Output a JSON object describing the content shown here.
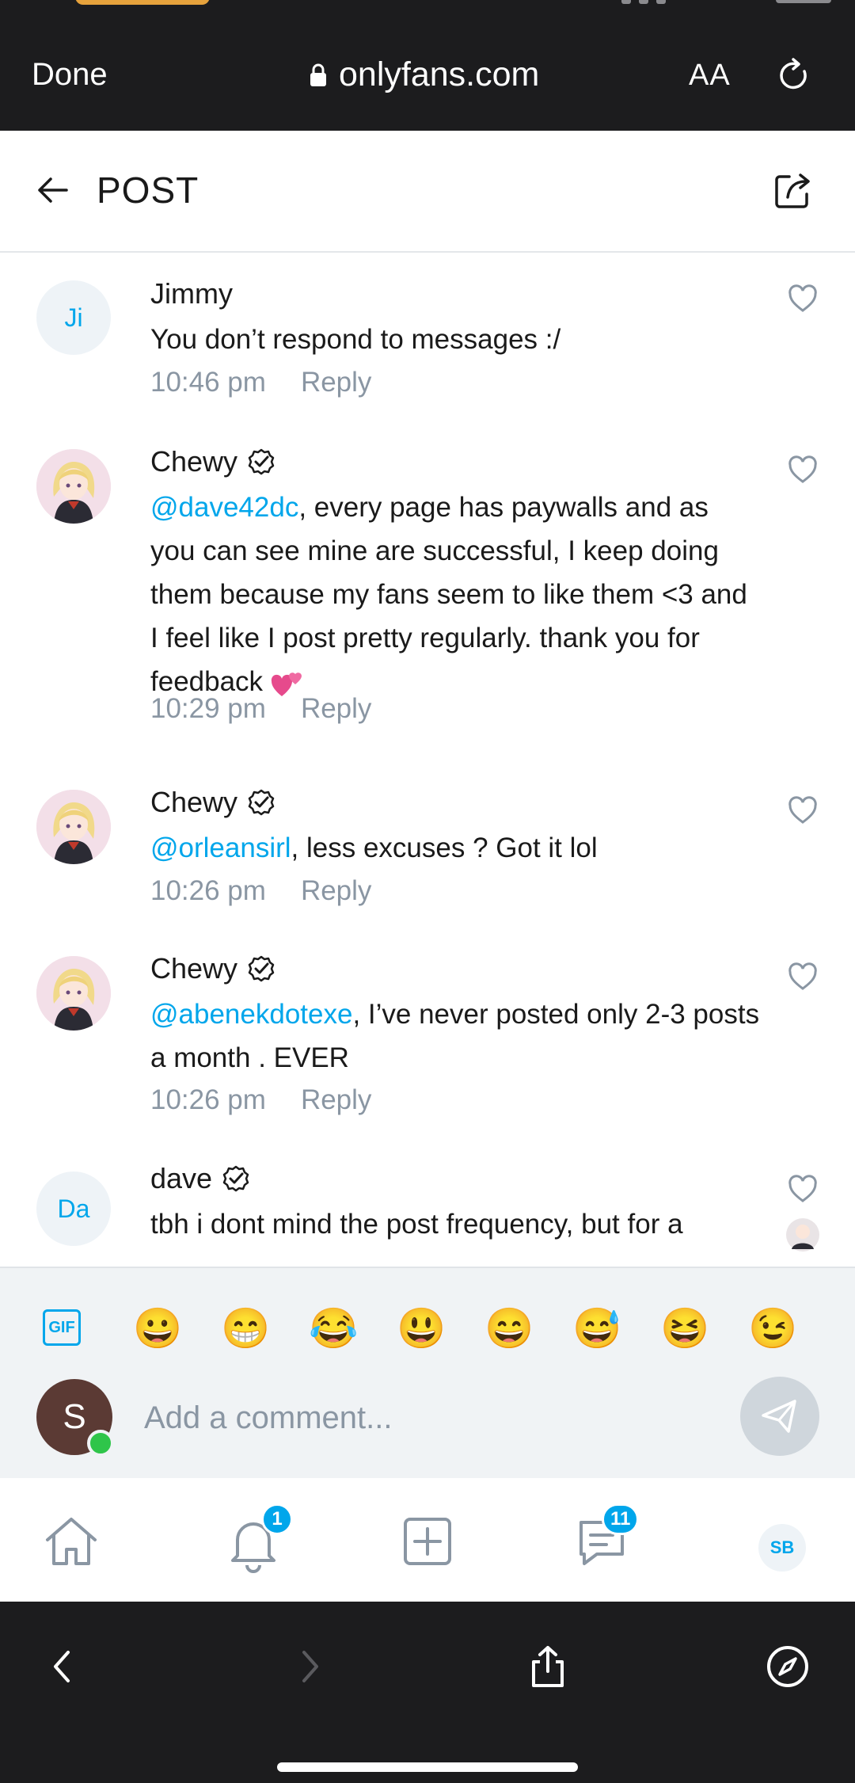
{
  "browser": {
    "done_label": "Done",
    "url": "onlyfans.com",
    "text_size_label": "AA"
  },
  "header": {
    "title": "POST"
  },
  "comments": [
    {
      "avatar_initials": "Ji",
      "name": "Jimmy",
      "verified": false,
      "mention": "",
      "text": "You don’t respond to messages :/",
      "time": "10:46 pm",
      "reply_label": "Reply"
    },
    {
      "avatar_initials": "",
      "name": "Chewy",
      "verified": true,
      "mention": "@dave42dc",
      "text": ", every page has paywalls and as you can see mine are successful, I keep doing them because my fans seem to like them <3 and I feel like I post pretty regularly. thank you for feedback",
      "emoji": "two-hearts",
      "time": "10:29 pm",
      "reply_label": "Reply"
    },
    {
      "avatar_initials": "",
      "name": "Chewy",
      "verified": true,
      "mention": "@orleansirl",
      "text": ", less excuses ? Got it lol",
      "time": "10:26 pm",
      "reply_label": "Reply"
    },
    {
      "avatar_initials": "",
      "name": "Chewy",
      "verified": true,
      "mention": "@abenekdotexe",
      "text": ", I’ve never posted only 2-3 posts a month . EVER",
      "time": "10:26 pm",
      "reply_label": "Reply"
    },
    {
      "avatar_initials": "Da",
      "name": "dave",
      "verified": true,
      "mention": "",
      "text": "tbh i dont mind the post frequency, but for a",
      "time": "",
      "reply_label": ""
    }
  ],
  "composer": {
    "gif_label": "GIF",
    "emojis": [
      "😀",
      "😁",
      "😂",
      "😃",
      "😄",
      "😅",
      "😆",
      "😉"
    ],
    "user_initial": "S",
    "placeholder": "Add a comment..."
  },
  "nav": {
    "notifications_badge": "1",
    "messages_badge": "11",
    "profile_initials": "SB"
  },
  "colors": {
    "accent": "#00a6eb",
    "browser_bar": "#1c1c1e",
    "muted_text": "#8a96a3"
  }
}
